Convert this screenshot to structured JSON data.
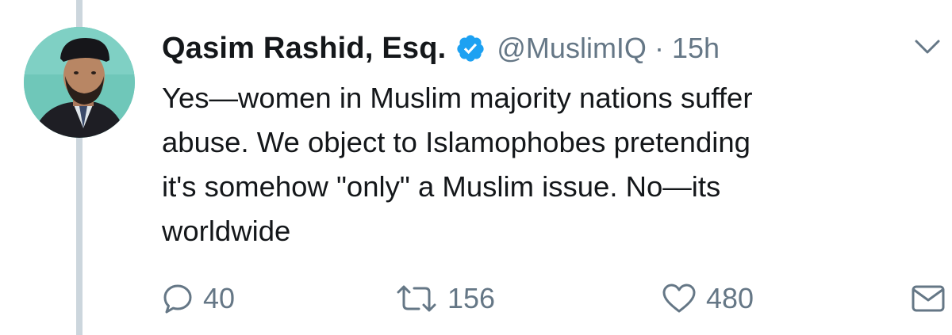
{
  "tweet": {
    "display_name": "Qasim Rashid, Esq.",
    "handle": "@MuslimIQ",
    "separator": "·",
    "timestamp": "15h",
    "text_lines": [
      "Yes—women in Muslim majority nations suffer",
      "abuse. We object to Islamophobes pretending",
      "it's somehow \"only\" a Muslim issue. No—its",
      "worldwide"
    ],
    "verified": true
  },
  "actions": {
    "reply_count": "40",
    "retweet_count": "156",
    "like_count": "480"
  },
  "colors": {
    "verified_blue": "#1da1f2",
    "secondary_text": "#657786",
    "thread_line": "#ccd6dd",
    "avatar_bg": "#6fc7b9"
  },
  "icons": {
    "verified": "verified-badge-icon",
    "caret": "chevron-down-icon",
    "reply": "reply-icon",
    "retweet": "retweet-icon",
    "like": "heart-icon",
    "dm": "envelope-icon"
  }
}
